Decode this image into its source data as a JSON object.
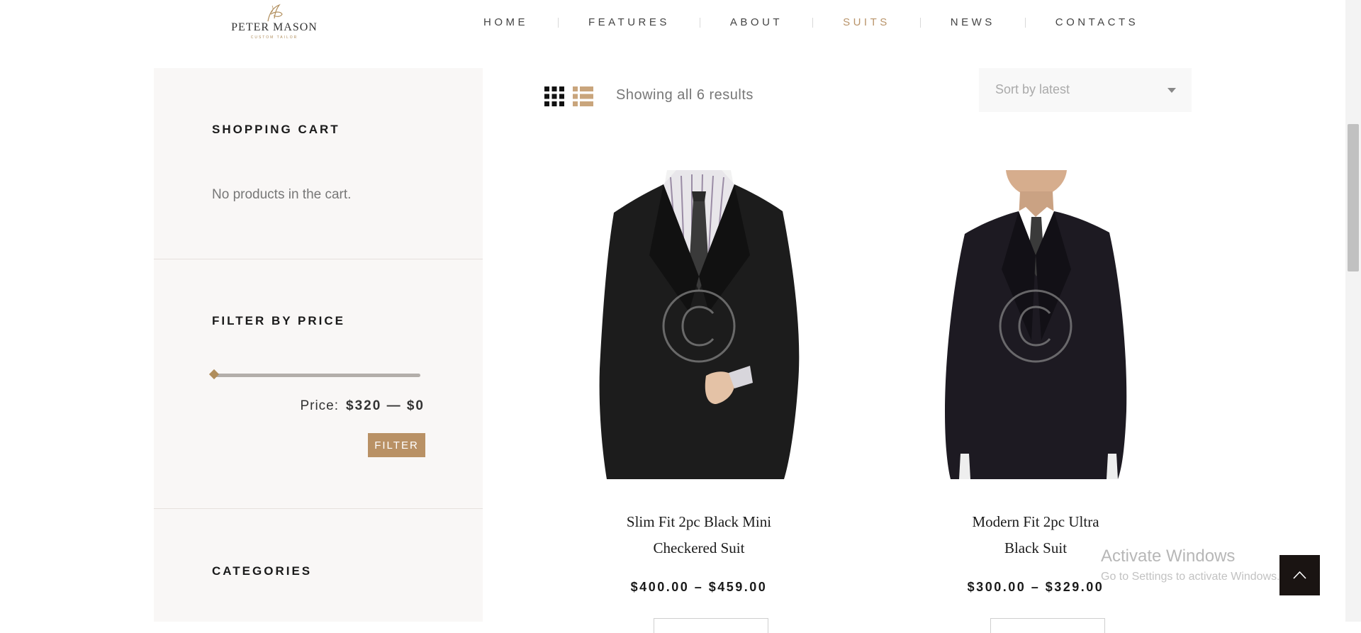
{
  "brand": {
    "name": "PETER MASON",
    "tagline": "CUSTOM TAILOR"
  },
  "nav": {
    "items": [
      {
        "label": "HOME"
      },
      {
        "label": "FEATURES"
      },
      {
        "label": "ABOUT"
      },
      {
        "label": "SUITS",
        "active": true
      },
      {
        "label": "NEWS"
      },
      {
        "label": "CONTACTS"
      }
    ]
  },
  "sidebar": {
    "cart": {
      "title": "SHOPPING CART",
      "empty_text": "No products in the cart."
    },
    "price_filter": {
      "title": "FILTER BY PRICE",
      "price_label": "Price:",
      "price_range": "$320 — $0",
      "button_label": "FILTER"
    },
    "categories": {
      "title": "CATEGORIES"
    }
  },
  "toolbar": {
    "view_modes": [
      "grid-icon",
      "list-icon"
    ],
    "results_text": "Showing all 6 results",
    "sort": {
      "selected": "Sort by latest"
    }
  },
  "products": [
    {
      "title_line1": "Slim Fit 2pc Black Mini",
      "title_line2": "Checkered Suit",
      "price": "$400.00 – $459.00"
    },
    {
      "title_line1": "Modern Fit 2pc Ultra",
      "title_line2": "Black Suit",
      "price": "$300.00 – $329.00"
    }
  ],
  "os_overlay": {
    "title": "Activate Windows",
    "subtitle": "Go to Settings to activate Windows."
  },
  "colors": {
    "accent": "#b9946a",
    "button": "#b99165",
    "sidebar_bg": "#f9f7f6",
    "back_to_top": "#1a1412"
  }
}
